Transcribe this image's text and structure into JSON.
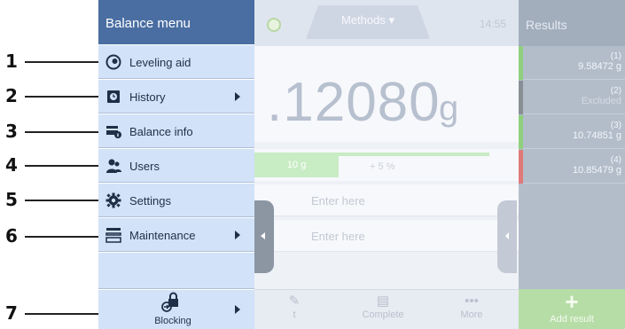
{
  "callouts": [
    "1",
    "2",
    "3",
    "4",
    "5",
    "6",
    "7"
  ],
  "menu": {
    "title": "Balance menu",
    "items": [
      {
        "label": "Leveling aid",
        "icon": "leveling-aid-icon"
      },
      {
        "label": "History",
        "icon": "history-icon",
        "has_submenu": true
      },
      {
        "label": "Balance info",
        "icon": "balance-info-icon"
      },
      {
        "label": "Users",
        "icon": "users-icon"
      },
      {
        "label": "Settings",
        "icon": "settings-gear-icon"
      },
      {
        "label": "Maintenance",
        "icon": "maintenance-icon",
        "has_submenu": true
      }
    ],
    "blocking": {
      "label": "Blocking",
      "icon": "blocking-lock-icon",
      "has_submenu": true
    }
  },
  "app": {
    "methods_tab": "Methods",
    "time": "14:55",
    "weight_value": ".12080",
    "weight_unit": "g",
    "tolerance_label": "10 g",
    "tolerance_percent": "+ 5 %",
    "fields": [
      "Enter here",
      "Enter here"
    ],
    "bottom_buttons": [
      {
        "label": "t",
        "icon": "pencil-icon"
      },
      {
        "label": "Complete",
        "icon": "printer-icon"
      },
      {
        "label": "More",
        "icon": "more-dots-icon"
      }
    ]
  },
  "results": {
    "title": "Results",
    "rows": [
      {
        "index": "(1)",
        "value": "9.58472 g",
        "status": "green"
      },
      {
        "index": "(2)",
        "value": "Excluded",
        "status": "gray"
      },
      {
        "index": "(3)",
        "value": "10.74851 g",
        "status": "green"
      },
      {
        "index": "(4)",
        "value": "10.85479 g",
        "status": "red"
      }
    ],
    "add_label": "Add result"
  },
  "colors": {
    "menu_header": "#4a6ea2",
    "menu_bg": "#d2e2f8",
    "status_green": "#8fd07e",
    "status_gray": "#8a8f96",
    "status_red": "#e07a7a",
    "add_result": "#b7dda7"
  }
}
